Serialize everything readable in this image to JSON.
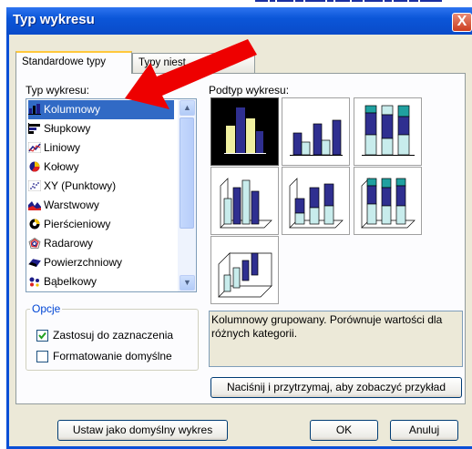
{
  "window": {
    "title": "Typ wykresu",
    "close": "X"
  },
  "tabs": [
    {
      "label": "Standardowe typy"
    },
    {
      "label": "Typy niest"
    }
  ],
  "chart_type_label": "Typ wykresu:",
  "subtype_label": "Podtyp wykresu:",
  "chart_types": [
    {
      "label": "Kolumnowy",
      "icon": "column-chart-icon",
      "selected": true
    },
    {
      "label": "Słupkowy",
      "icon": "bar-chart-icon",
      "selected": false
    },
    {
      "label": "Liniowy",
      "icon": "line-chart-icon",
      "selected": false
    },
    {
      "label": "Kołowy",
      "icon": "pie-chart-icon",
      "selected": false
    },
    {
      "label": "XY (Punktowy)",
      "icon": "scatter-chart-icon",
      "selected": false
    },
    {
      "label": "Warstwowy",
      "icon": "area-chart-icon",
      "selected": false
    },
    {
      "label": "Pierścieniowy",
      "icon": "doughnut-chart-icon",
      "selected": false
    },
    {
      "label": "Radarowy",
      "icon": "radar-chart-icon",
      "selected": false
    },
    {
      "label": "Powierzchniowy",
      "icon": "surface-chart-icon",
      "selected": false
    },
    {
      "label": "Bąbelkowy",
      "icon": "bubble-chart-icon",
      "selected": false
    }
  ],
  "options": {
    "group_label": "Opcje",
    "apply_to_selection": {
      "label": "Zastosuj do zaznaczenia",
      "checked": true
    },
    "default_formatting": {
      "label": "Formatowanie domyślne",
      "checked": false
    }
  },
  "description": "Kolumnowy grupowany. Porównuje wartości dla różnych kategorii.",
  "buttons": {
    "preview": "Naciśnij i przytrzymaj, aby zobaczyć przykład",
    "set_default": "Ustaw jako domyślny wykres",
    "ok": "OK",
    "cancel": "Anuluj"
  },
  "colors": {
    "accent": "#0a4fd6",
    "selection": "#316ac5",
    "arrow": "#ee0000"
  }
}
